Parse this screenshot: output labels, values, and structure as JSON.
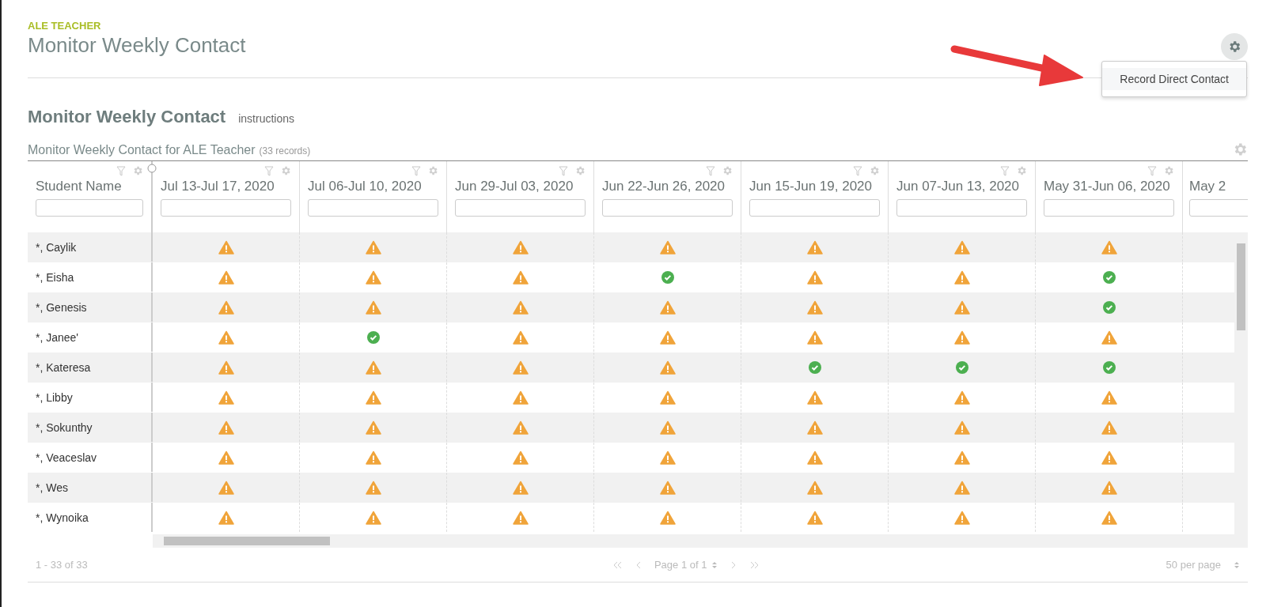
{
  "header": {
    "section": "ALE TEACHER",
    "title": "Monitor Weekly Contact"
  },
  "settings_menu": {
    "items": [
      "Record Direct Contact"
    ]
  },
  "page_heading": {
    "title": "Monitor Weekly Contact",
    "link": "instructions"
  },
  "grid": {
    "title": "Monitor Weekly Contact for ALE Teacher",
    "count": "(33 records)",
    "name_column": "Student Name",
    "date_columns": [
      "Jul 13-Jul 17, 2020",
      "Jul 06-Jul 10, 2020",
      "Jun 29-Jul 03, 2020",
      "Jun 22-Jun 26, 2020",
      "Jun 15-Jun 19, 2020",
      "Jun 07-Jun 13, 2020",
      "May 31-Jun 06, 2020",
      "May 2"
    ],
    "rows": [
      {
        "name": "*, Caylik",
        "cells": [
          {
            "kind": "warning"
          },
          {
            "kind": "warning"
          },
          {
            "kind": "warning"
          },
          {
            "kind": "warning"
          },
          {
            "kind": "warning"
          },
          {
            "kind": "warning"
          },
          {
            "kind": "warning"
          }
        ]
      },
      {
        "name": "*, Eisha",
        "cells": [
          {
            "kind": "warning"
          },
          {
            "kind": "warning"
          },
          {
            "kind": "warning"
          },
          {
            "kind": "ok"
          },
          {
            "kind": "warning"
          },
          {
            "kind": "warning"
          },
          {
            "kind": "ok"
          }
        ]
      },
      {
        "name": "*, Genesis",
        "cells": [
          {
            "kind": "warning"
          },
          {
            "kind": "warning"
          },
          {
            "kind": "warning"
          },
          {
            "kind": "warning"
          },
          {
            "kind": "warning"
          },
          {
            "kind": "warning"
          },
          {
            "kind": "ok"
          }
        ]
      },
      {
        "name": "*, Janee'",
        "cells": [
          {
            "kind": "warning"
          },
          {
            "kind": "ok"
          },
          {
            "kind": "warning"
          },
          {
            "kind": "warning"
          },
          {
            "kind": "warning"
          },
          {
            "kind": "warning"
          },
          {
            "kind": "warning"
          }
        ]
      },
      {
        "name": "*, Kateresa",
        "cells": [
          {
            "kind": "warning"
          },
          {
            "kind": "warning"
          },
          {
            "kind": "warning"
          },
          {
            "kind": "warning"
          },
          {
            "kind": "ok"
          },
          {
            "kind": "ok"
          },
          {
            "kind": "ok"
          }
        ]
      },
      {
        "name": "*, Libby",
        "cells": [
          {
            "kind": "warning"
          },
          {
            "kind": "warning"
          },
          {
            "kind": "warning"
          },
          {
            "kind": "warning"
          },
          {
            "kind": "warning"
          },
          {
            "kind": "warning"
          },
          {
            "kind": "warning"
          }
        ]
      },
      {
        "name": "*, Sokunthy",
        "cells": [
          {
            "kind": "warning"
          },
          {
            "kind": "warning"
          },
          {
            "kind": "warning"
          },
          {
            "kind": "warning"
          },
          {
            "kind": "warning"
          },
          {
            "kind": "warning"
          },
          {
            "kind": "warning"
          }
        ]
      },
      {
        "name": "*, Veaceslav",
        "cells": [
          {
            "kind": "warning"
          },
          {
            "kind": "warning"
          },
          {
            "kind": "warning"
          },
          {
            "kind": "warning"
          },
          {
            "kind": "warning"
          },
          {
            "kind": "warning"
          },
          {
            "kind": "warning"
          }
        ]
      },
      {
        "name": "*, Wes",
        "cells": [
          {
            "kind": "warning"
          },
          {
            "kind": "warning"
          },
          {
            "kind": "warning"
          },
          {
            "kind": "warning"
          },
          {
            "kind": "warning"
          },
          {
            "kind": "warning"
          },
          {
            "kind": "warning"
          }
        ]
      },
      {
        "name": "*, Wynoika",
        "cells": [
          {
            "kind": "warning"
          },
          {
            "kind": "warning"
          },
          {
            "kind": "warning"
          },
          {
            "kind": "warning"
          },
          {
            "kind": "warning"
          },
          {
            "kind": "warning"
          },
          {
            "kind": "warning"
          }
        ]
      }
    ]
  },
  "footer": {
    "range": "1 - 33 of 33",
    "page": "Page 1 of 1",
    "per_page": "50 per page"
  }
}
